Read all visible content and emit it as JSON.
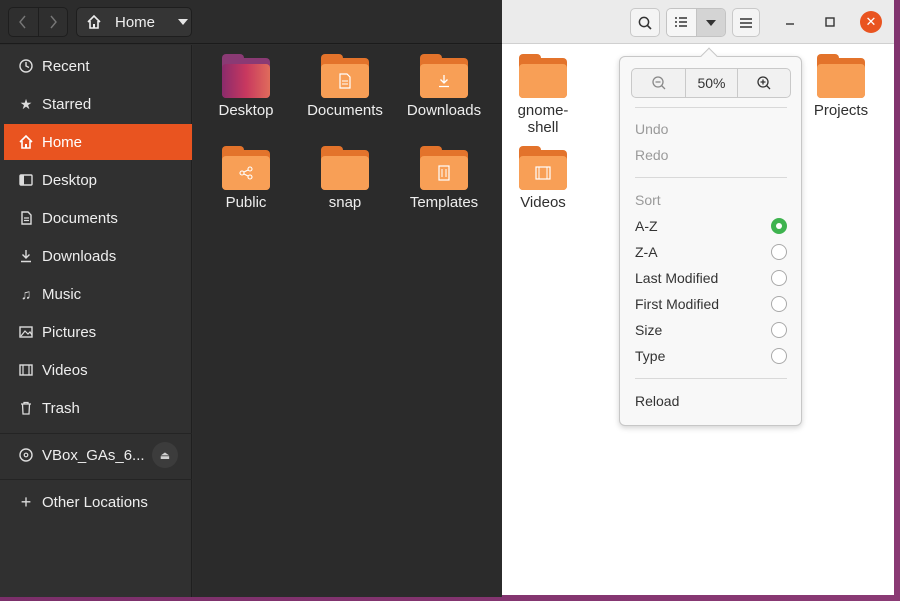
{
  "window": {
    "path_label": "Home",
    "nav_back_icon": "chevron-left-icon",
    "nav_forward_icon": "chevron-right-icon"
  },
  "sidebar": {
    "items": [
      {
        "label": "Recent",
        "icon": "clock-icon"
      },
      {
        "label": "Starred",
        "icon": "star-icon"
      },
      {
        "label": "Home",
        "icon": "home-icon",
        "active": true
      },
      {
        "label": "Desktop",
        "icon": "desktop-icon"
      },
      {
        "label": "Documents",
        "icon": "document-icon"
      },
      {
        "label": "Downloads",
        "icon": "download-icon"
      },
      {
        "label": "Music",
        "icon": "music-icon"
      },
      {
        "label": "Pictures",
        "icon": "picture-icon"
      },
      {
        "label": "Videos",
        "icon": "video-icon"
      },
      {
        "label": "Trash",
        "icon": "trash-icon"
      }
    ],
    "device": {
      "label": "VBox_GAs_6...",
      "icon": "disc-icon"
    },
    "other": {
      "label": "Other Locations",
      "icon": "plus-icon"
    },
    "accent": "#e95420"
  },
  "files": [
    {
      "label": "Desktop"
    },
    {
      "label": "Documents"
    },
    {
      "label": "Downloads"
    },
    {
      "label": "gnome-\nshell"
    },
    {
      "label": "Projects"
    },
    {
      "label": "Public"
    },
    {
      "label": "snap"
    },
    {
      "label": "Templates"
    },
    {
      "label": "Videos"
    }
  ],
  "menu": {
    "zoom_level": "50%",
    "undo": "Undo",
    "redo": "Redo",
    "sort_header": "Sort",
    "sort_options": [
      {
        "label": "A-Z",
        "selected": true
      },
      {
        "label": "Z-A",
        "selected": false
      },
      {
        "label": "Last Modified",
        "selected": false
      },
      {
        "label": "First Modified",
        "selected": false
      },
      {
        "label": "Size",
        "selected": false
      },
      {
        "label": "Type",
        "selected": false
      }
    ],
    "reload": "Reload"
  }
}
